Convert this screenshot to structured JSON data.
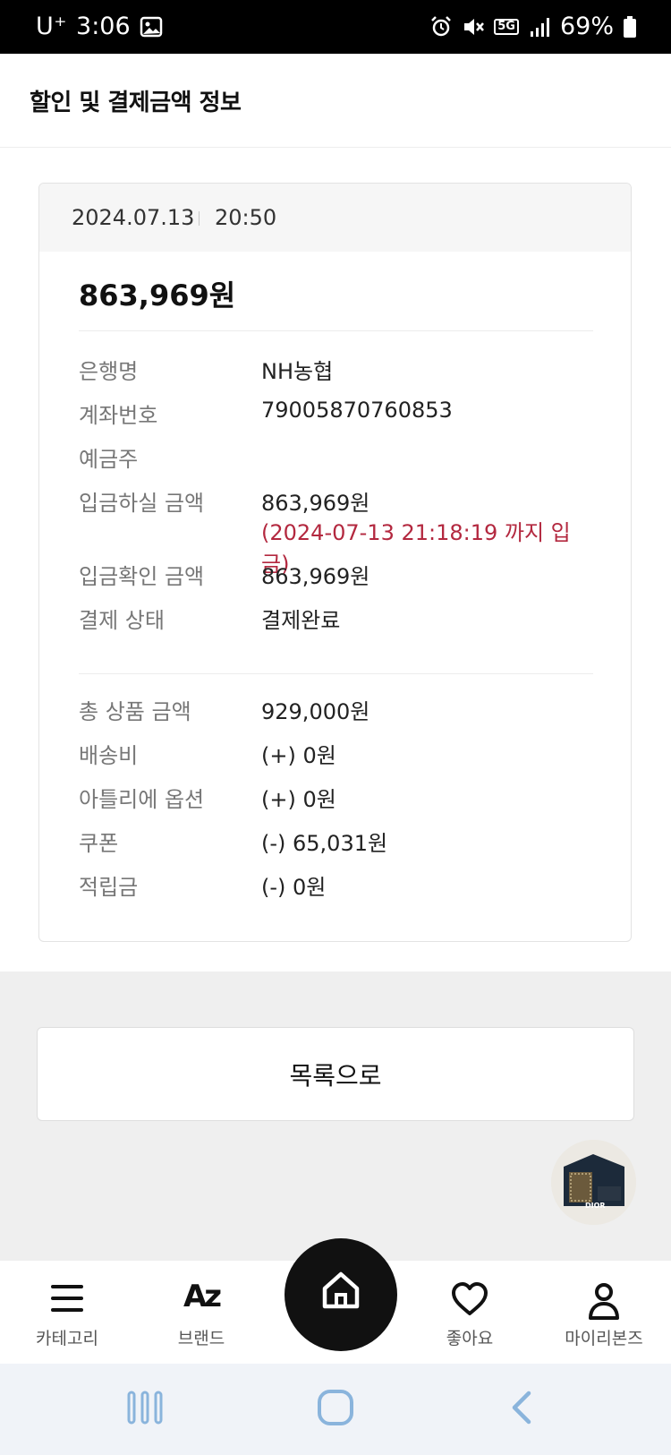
{
  "status_bar": {
    "carrier": "U⁺",
    "time": "3:06",
    "network": "5G",
    "battery": "69%"
  },
  "header": {
    "title": "할인 및 결제금액 정보"
  },
  "payment": {
    "date": "2024.07.13",
    "time": "20:50",
    "total": "863,969원",
    "details": [
      {
        "label": "은행명",
        "value": "NH농협"
      },
      {
        "label": "계좌번호",
        "value": "79005870760853"
      },
      {
        "label": "예금주",
        "value": ""
      },
      {
        "label": "입금하실 금액",
        "value": "863,969원",
        "note": "(2024-07-13 21:18:19 까지 입금)"
      },
      {
        "label": "입금확인 금액",
        "value": "863,969원"
      },
      {
        "label": "결제 상태",
        "value": "결제완료"
      }
    ],
    "breakdown": [
      {
        "label": "총 상품 금액",
        "value": "929,000원"
      },
      {
        "label": "배송비",
        "value": "(+) 0원"
      },
      {
        "label": "아틀리에 옵션",
        "value": "(+) 0원"
      },
      {
        "label": "쿠폰",
        "value": "(-) 65,031원"
      },
      {
        "label": "적립금",
        "value": "(-) 0원"
      }
    ]
  },
  "list_button": "목록으로",
  "floating_thumbnail": {
    "brand_text": "DIOR"
  },
  "bottom_nav": {
    "category": "카테고리",
    "brand": "브랜드",
    "brand_icon_text": "Az",
    "likes": "좋아요",
    "my": "마이리본즈"
  },
  "colors": {
    "accent_red": "#b3283f",
    "card_header_bg": "#f6f6f6",
    "gray_area_bg": "#efefef",
    "home_button": "#111111",
    "system_nav_icon": "#8ab4dc"
  }
}
